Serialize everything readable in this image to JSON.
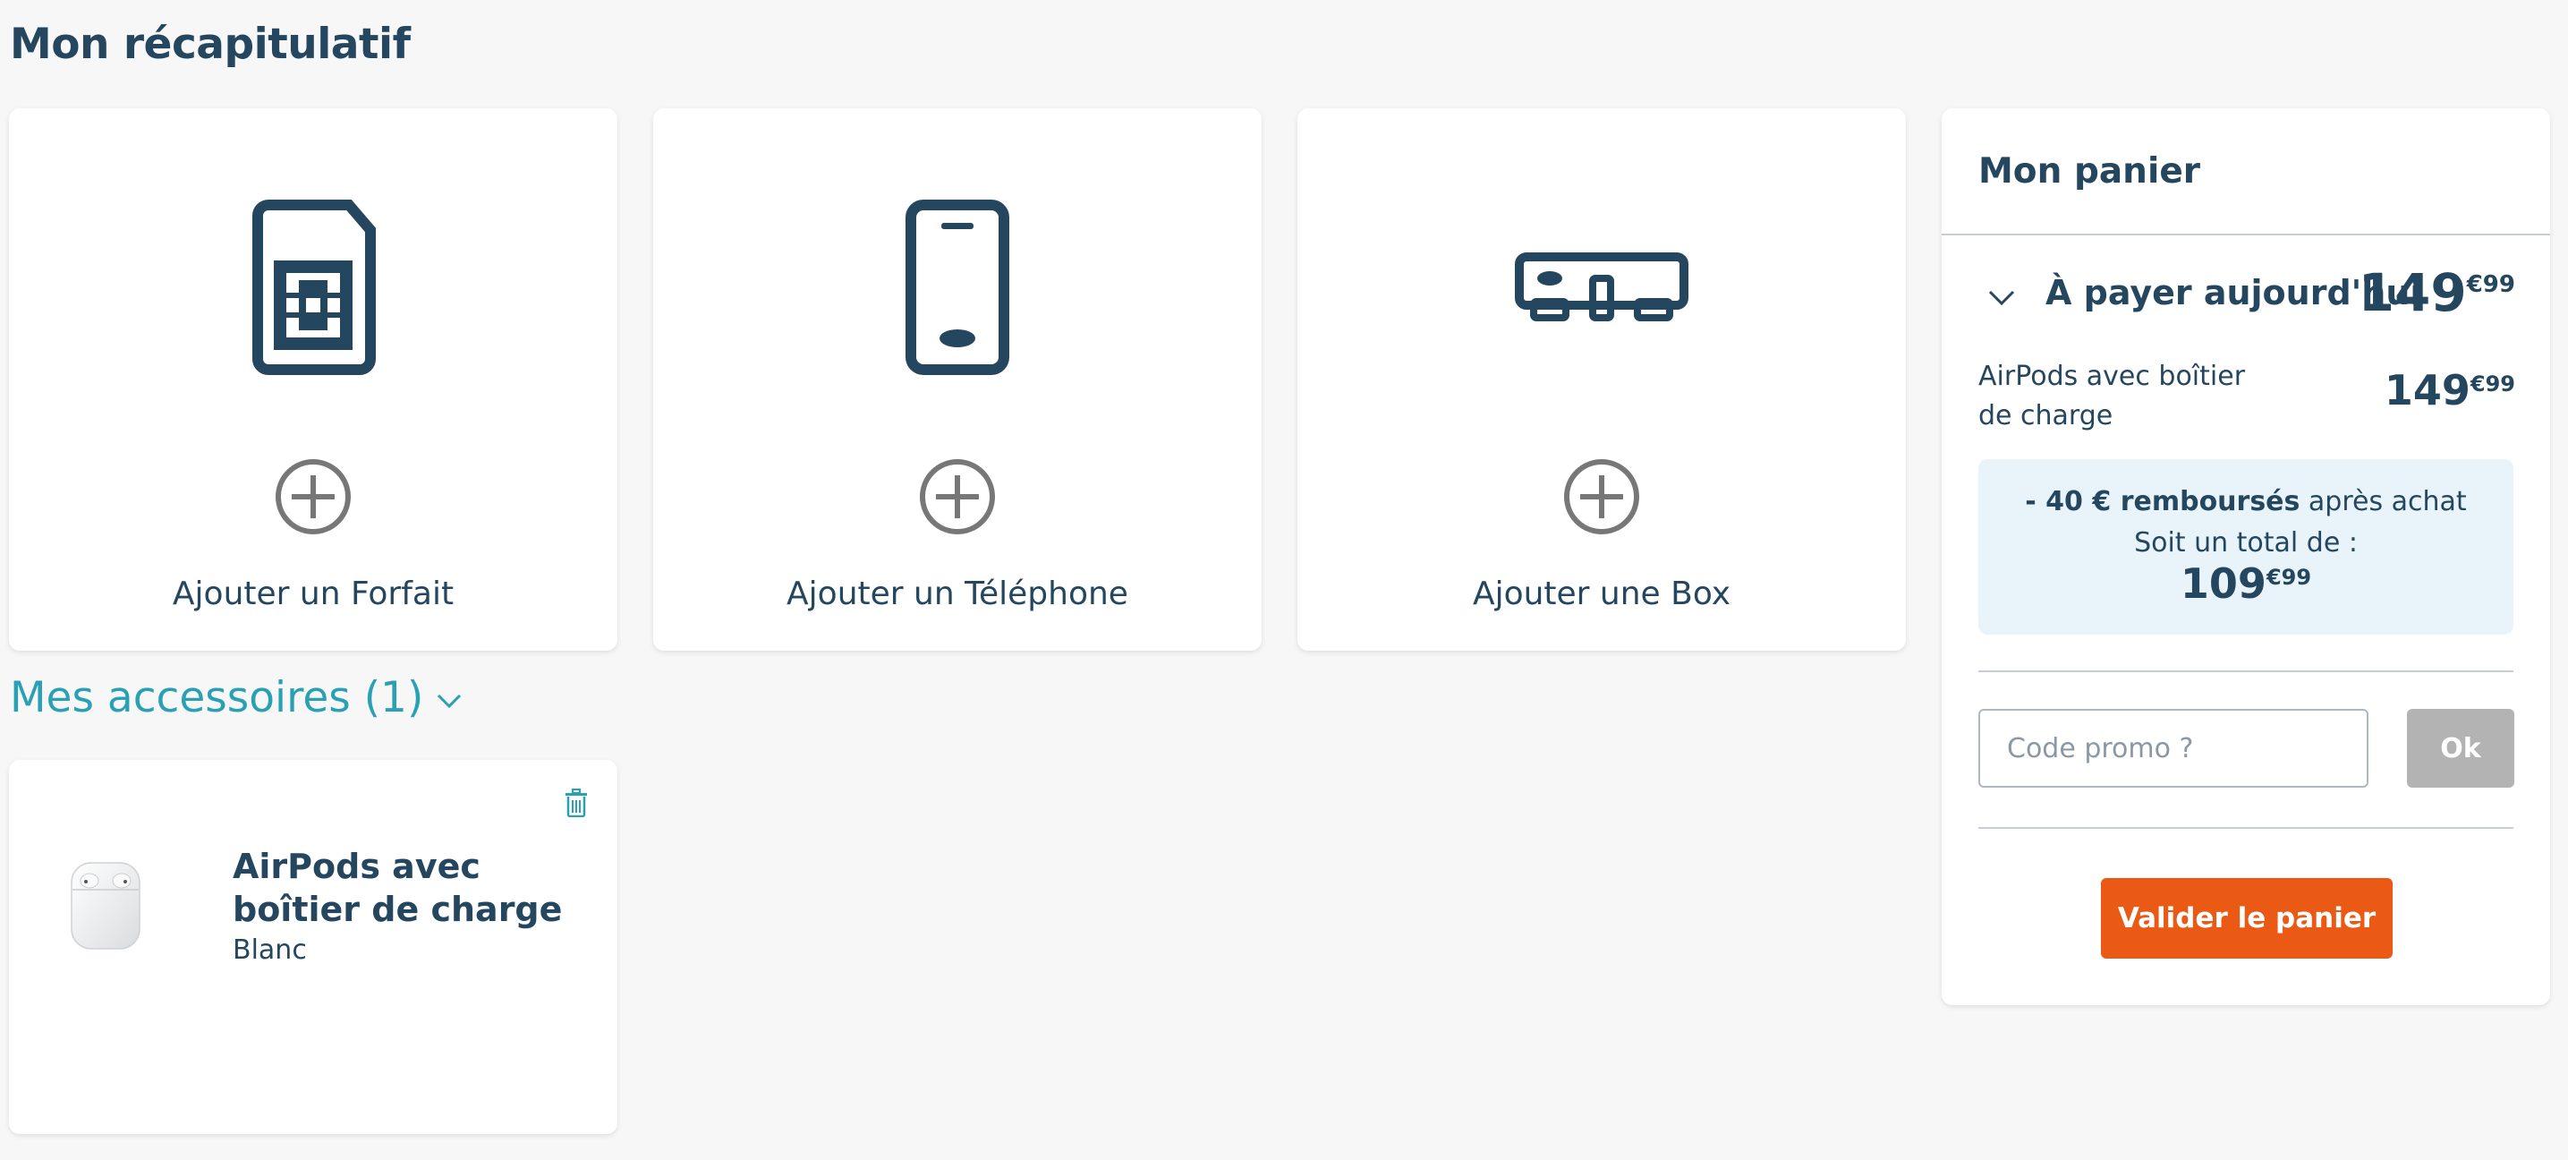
{
  "page": {
    "title": "Mon récapitulatif"
  },
  "products": [
    {
      "label": "Ajouter un Forfait",
      "icon": "sim-card-icon"
    },
    {
      "label": "Ajouter un Téléphone",
      "icon": "smartphone-icon"
    },
    {
      "label": "Ajouter une Box",
      "icon": "internet-box-icon"
    }
  ],
  "accessories": {
    "heading": "Mes accessoires (1)",
    "items": [
      {
        "name": "AirPods avec boîtier de charge",
        "color": "Blanc"
      }
    ]
  },
  "cart": {
    "title": "Mon panier",
    "pay_today_label": "À payer aujourd'hui",
    "pay_today_price": {
      "int": "149",
      "cents": "€99"
    },
    "item": {
      "name": "AirPods avec boîtier de charge",
      "price": {
        "int": "149",
        "cents": "€99"
      }
    },
    "promo": {
      "refund_bold": "- 40 € remboursés",
      "refund_rest": " après achat",
      "total_label": "Soit un total de :",
      "total": {
        "int": "109",
        "cents": "€99"
      }
    },
    "promo_code_placeholder": "Code promo ?",
    "ok_label": "Ok",
    "validate_label": "Valider le panier"
  },
  "colors": {
    "navy": "#25465f",
    "teal": "#2aa0b4",
    "orange": "#ea5a14",
    "disabled_grey": "#b3b3b3",
    "info_bg": "#e8f4f9"
  }
}
